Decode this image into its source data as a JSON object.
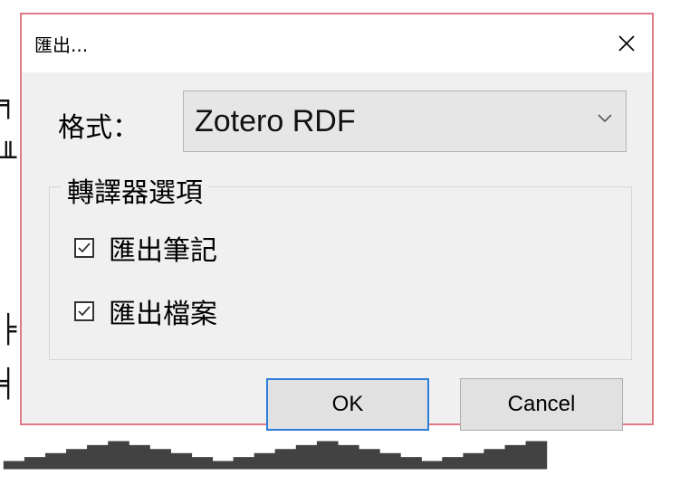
{
  "dialog": {
    "title": "匯出...",
    "close_icon": "close-icon"
  },
  "format": {
    "label": "格式：",
    "selected": "Zotero RDF"
  },
  "translator_options": {
    "legend": "轉譯器選項",
    "items": [
      {
        "label": "匯出筆記",
        "checked": true
      },
      {
        "label": "匯出檔案",
        "checked": true
      }
    ]
  },
  "buttons": {
    "ok": "OK",
    "cancel": "Cancel"
  },
  "colors": {
    "dialog_border": "#e07a86",
    "focus_accent": "#2b7fd8",
    "dialog_bg": "#f0f0f0"
  }
}
